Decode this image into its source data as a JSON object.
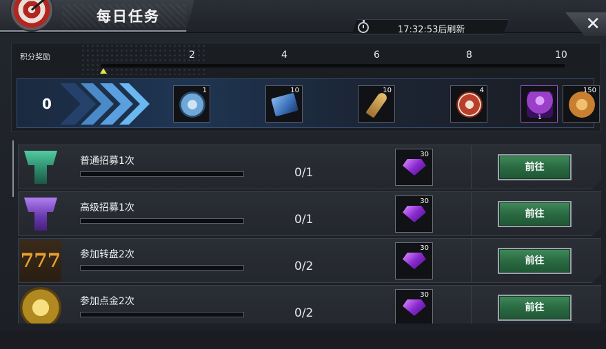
{
  "header": {
    "title": "每日任务",
    "refresh_text": "17:32:53后刷新",
    "close_icon": "close-icon"
  },
  "rewards": {
    "label": "积分奖励",
    "current_score": "0",
    "milestones": [
      "2",
      "4",
      "6",
      "8",
      "10"
    ],
    "progress_fraction": 0,
    "items": [
      {
        "icon": "coin-token-icon",
        "count": "1",
        "color": "#6fa8d8"
      },
      {
        "icon": "cinema-ticket-icon",
        "count": "10",
        "color": "#3a6fb8"
      },
      {
        "icon": "bullet-icon",
        "count": "10",
        "color": "#c8a040"
      },
      {
        "icon": "casino-chip-icon",
        "count": "4",
        "color": "#b8402a"
      },
      {
        "icon": "purple-character-icon",
        "count": "1",
        "color": "#9a40c8"
      },
      {
        "icon": "medal-coin-icon",
        "count": "150",
        "color": "#c88030"
      }
    ]
  },
  "tasks": [
    {
      "name": "普通招募1次",
      "progress": "0/1",
      "fraction": 0,
      "reward_count": "30",
      "button": "前往",
      "icon": "green-recruit-icon",
      "icon_color": "#2d8a6a"
    },
    {
      "name": "高级招募1次",
      "progress": "0/1",
      "fraction": 0,
      "reward_count": "30",
      "button": "前往",
      "icon": "purple-recruit-icon",
      "icon_color": "#6a3ab0"
    },
    {
      "name": "参加转盘2次",
      "progress": "0/2",
      "fraction": 0,
      "reward_count": "30",
      "button": "前往",
      "icon": "slot-777-icon",
      "icon_color": "#8a5a20"
    },
    {
      "name": "参加点金2次",
      "progress": "0/2",
      "fraction": 0,
      "reward_count": "30",
      "button": "前往",
      "icon": "gold-diamond-icon",
      "icon_color": "#b08a20"
    }
  ]
}
